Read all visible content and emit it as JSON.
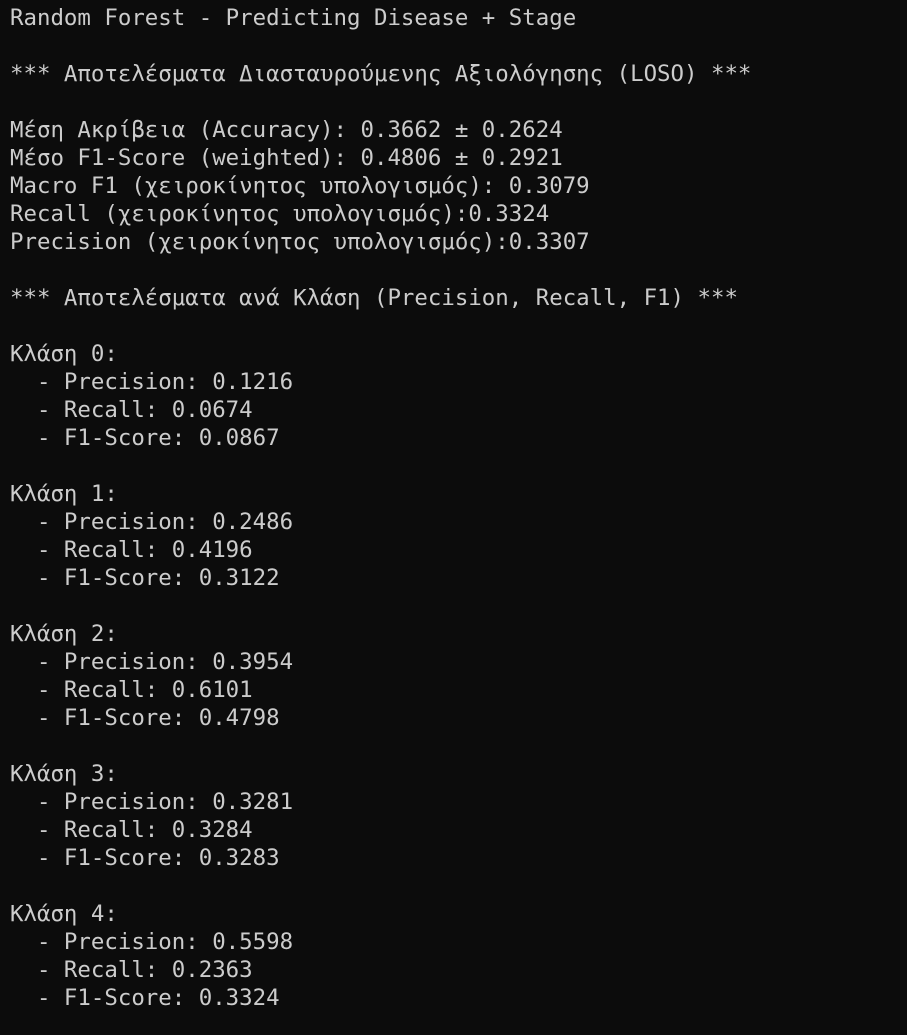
{
  "title": "Random Forest - Predicting Disease + Stage",
  "cv_header": "*** Αποτελέσματα Διασταυρούμενης Αξιολόγησης (LOSO) ***",
  "summary": [
    "Μέση Ακρίβεια (Accuracy): 0.3662 ± 0.2624",
    "Μέσο F1-Score (weighted): 0.4806 ± 0.2921",
    "Macro F1 (χειροκίνητος υπολογισμός): 0.3079",
    "Recall (χειροκίνητος υπολογισμός):0.3324",
    "Precision (χειροκίνητος υπολογισμός):0.3307"
  ],
  "class_header": "*** Αποτελέσματα ανά Κλάση (Precision, Recall, F1) ***",
  "classes": [
    {
      "label": "Κλάση 0:",
      "precision": "  - Precision: 0.1216",
      "recall": "  - Recall: 0.0674",
      "f1": "  - F1-Score: 0.0867"
    },
    {
      "label": "Κλάση 1:",
      "precision": "  - Precision: 0.2486",
      "recall": "  - Recall: 0.4196",
      "f1": "  - F1-Score: 0.3122"
    },
    {
      "label": "Κλάση 2:",
      "precision": "  - Precision: 0.3954",
      "recall": "  - Recall: 0.6101",
      "f1": "  - F1-Score: 0.4798"
    },
    {
      "label": "Κλάση 3:",
      "precision": "  - Precision: 0.3281",
      "recall": "  - Recall: 0.3284",
      "f1": "  - F1-Score: 0.3283"
    },
    {
      "label": "Κλάση 4:",
      "precision": "  - Precision: 0.5598",
      "recall": "  - Recall: 0.2363",
      "f1": "  - F1-Score: 0.3324"
    }
  ]
}
